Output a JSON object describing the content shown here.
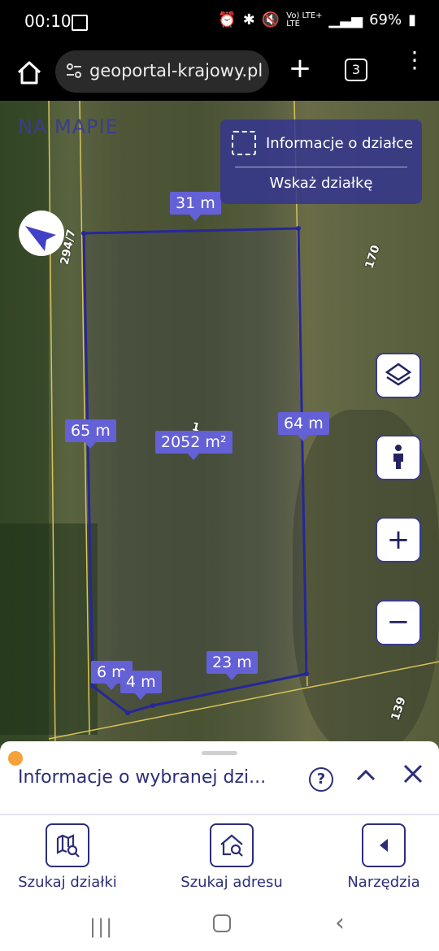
{
  "status_bar": {
    "time": "00:10",
    "network": "Vo) LTE+",
    "network2": "LTE",
    "battery": "69%"
  },
  "browser": {
    "url": "geoportal-krajowy.pl",
    "tab_count": "3",
    "new_tab": "+"
  },
  "app": {
    "logo_text": "NA MAPIE",
    "info_panel": {
      "title": "Informacje o działce",
      "action": "Wskaż działkę"
    },
    "map_controls": {
      "zoom_in": "+",
      "zoom_out": "−"
    }
  },
  "map": {
    "labels": {
      "top": "31 m",
      "left": "65 m",
      "right": "64 m",
      "area": "2052 m²",
      "bottom_right": "23 m",
      "bottom_left_a": "6 m",
      "bottom_left_b": "4 m"
    },
    "plot_numbers": {
      "left": "294/7",
      "right": "170",
      "bottom": "139",
      "center": "1"
    }
  },
  "bottom_sheet": {
    "title": "Informacje o wybranej dzi...",
    "help": "?",
    "collapse": "^",
    "close": "×"
  },
  "bottom_nav": [
    {
      "label": "Szukaj działki"
    },
    {
      "label": "Szukaj adresu"
    },
    {
      "label": "Narzędzia"
    }
  ]
}
